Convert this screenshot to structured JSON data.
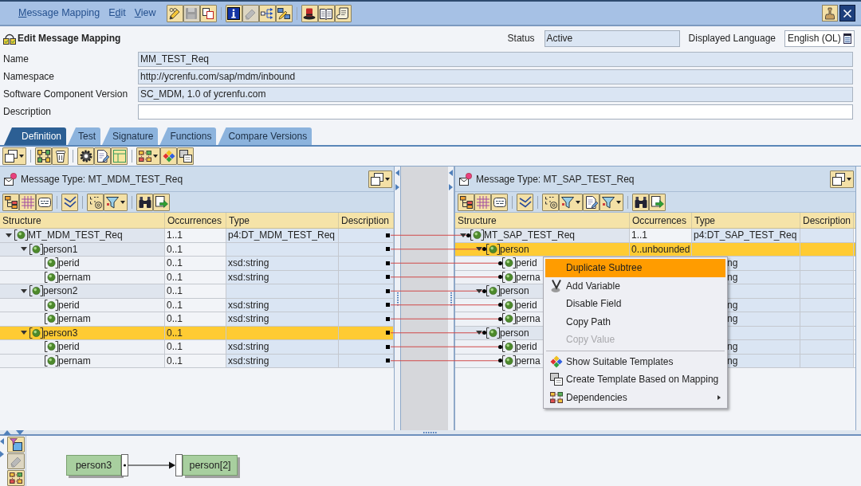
{
  "menu_bar": {
    "items": [
      {
        "key": "M",
        "post": "essage Mapping"
      },
      {
        "pre": "E",
        "key": "d",
        "post": "it"
      },
      {
        "key": "V",
        "post": "iew"
      }
    ]
  },
  "toolbar": {
    "groups": [
      [
        {
          "kind": "edit",
          "disabled": false
        },
        {
          "kind": "save",
          "disabled": true
        },
        {
          "kind": "copy",
          "disabled": false
        }
      ],
      [
        {
          "kind": "info",
          "disabled": false
        },
        {
          "kind": "eraser",
          "disabled": true
        },
        {
          "kind": "network",
          "disabled": false
        },
        {
          "kind": "compare",
          "disabled": false
        }
      ],
      [
        {
          "kind": "hat",
          "disabled": false
        },
        {
          "kind": "book",
          "disabled": false
        },
        {
          "kind": "scroll",
          "disabled": false
        }
      ]
    ]
  },
  "editor": {
    "title": "Edit Message Mapping",
    "status": {
      "label": "Status",
      "value": "Active"
    },
    "language": {
      "label": "Displayed Language",
      "value": "English (OL)"
    }
  },
  "fields": [
    {
      "label": "Name",
      "value": "MM_TEST_Req",
      "editable": false
    },
    {
      "label": "Namespace",
      "value": "http://ycrenfu.com/sap/mdm/inbound",
      "editable": false
    },
    {
      "label": "Software Component Version",
      "value": "SC_MDM, 1.0 of ycrenfu.com",
      "editable": false
    },
    {
      "label": "Description",
      "editable": true
    }
  ],
  "tabs": [
    {
      "label": "Definition",
      "selected": true
    },
    {
      "label": "Test",
      "selected": false
    },
    {
      "label": "Signature",
      "selected": false
    },
    {
      "label": "Functions",
      "selected": false
    },
    {
      "label": "Compare Versions",
      "selected": false
    }
  ],
  "source": {
    "title": "Message Type: MT_MDM_TEST_Req",
    "columns": [
      "Structure",
      "Occurrences",
      "Type",
      "Description"
    ],
    "tree": [
      {
        "name": "MT_MDM_TEST_Req",
        "occurrences": "1..1",
        "type": "p4:DT_MDM_TEST_Req",
        "expanded": true,
        "selected": false,
        "mapped": true,
        "children": [
          {
            "name": "person1",
            "occurrences": "0..1",
            "expanded": true,
            "selected": false,
            "mapped": true,
            "children": [
              {
                "name": "perid",
                "occurrences": "0..1",
                "type": "xsd:string",
                "selected": false,
                "mapped": true
              },
              {
                "name": "pernam",
                "occurrences": "0..1",
                "type": "xsd:string",
                "selected": false,
                "mapped": true
              }
            ]
          },
          {
            "name": "person2",
            "occurrences": "0..1",
            "expanded": true,
            "selected": false,
            "mapped": true,
            "children": [
              {
                "name": "perid",
                "occurrences": "0..1",
                "type": "xsd:string",
                "selected": false,
                "mapped": true
              },
              {
                "name": "pernam",
                "occurrences": "0..1",
                "type": "xsd:string",
                "selected": false,
                "mapped": true
              }
            ]
          },
          {
            "name": "person3",
            "occurrences": "0..1",
            "expanded": true,
            "selected": true,
            "mapped": true,
            "children": [
              {
                "name": "perid",
                "occurrences": "0..1",
                "type": "xsd:string",
                "selected": false,
                "mapped": true
              },
              {
                "name": "pernam",
                "occurrences": "0..1",
                "type": "xsd:string",
                "selected": false,
                "mapped": true
              }
            ]
          }
        ]
      }
    ]
  },
  "target": {
    "title": "Message Type: MT_SAP_TEST_Req",
    "columns": [
      "Structure",
      "Occurrences",
      "Type",
      "Description"
    ],
    "tree": [
      {
        "name": "MT_SAP_TEST_Req",
        "occurrences": "1..1",
        "type": "p4:DT_SAP_TEST_Req",
        "expanded": true,
        "selected": false,
        "mapped": true,
        "children": [
          {
            "name": "person",
            "occurrences": "0..unbounded",
            "expanded": true,
            "selected": true,
            "mapped": true,
            "children": [
              {
                "name": "perid",
                "type": "ng",
                "selected": false,
                "mapped": true
              },
              {
                "name": "perna",
                "type": "ng",
                "selected": false,
                "mapped": true
              }
            ]
          },
          {
            "name": "person",
            "expanded": true,
            "selected": false,
            "mapped": true,
            "children": [
              {
                "name": "perid",
                "type": "ng",
                "selected": false,
                "mapped": true
              },
              {
                "name": "perna",
                "type": "ng",
                "selected": false,
                "mapped": true
              }
            ]
          },
          {
            "name": "person",
            "expanded": true,
            "selected": false,
            "mapped": true,
            "children": [
              {
                "name": "perid",
                "type": "ng",
                "selected": false,
                "mapped": true
              },
              {
                "name": "perna",
                "type": "ng",
                "selected": false,
                "mapped": true
              }
            ]
          }
        ]
      }
    ]
  },
  "context_menu": {
    "groups": [
      [
        {
          "label": "Duplicate Subtree",
          "kind": "plain",
          "selected": true,
          "disabled": false,
          "submenu": false
        },
        {
          "label": "Add Variable",
          "kind": "variable",
          "selected": false,
          "disabled": false,
          "submenu": false
        },
        {
          "label": "Disable Field",
          "kind": "plain",
          "selected": false,
          "disabled": false,
          "submenu": false
        },
        {
          "label": "Copy Path",
          "kind": "plain",
          "selected": false,
          "disabled": false,
          "submenu": false
        },
        {
          "label": "Copy Value",
          "kind": "plain",
          "selected": false,
          "disabled": true,
          "submenu": false
        }
      ],
      [
        {
          "label": "Show Suitable Templates",
          "kind": "diamonds",
          "selected": false,
          "disabled": false,
          "submenu": false
        },
        {
          "label": "Create Template Based on Mapping",
          "kind": "template",
          "selected": false,
          "disabled": false,
          "submenu": false
        },
        {
          "label": "Dependencies",
          "kind": "dependencies",
          "selected": false,
          "disabled": false,
          "submenu": true
        }
      ]
    ]
  },
  "mapping_diagram": {
    "nodes": [
      {
        "label": "person3"
      },
      {
        "label": "person[2]"
      }
    ]
  },
  "side_toolbar": [
    {
      "kind": "filter_box",
      "disabled": false
    },
    {
      "kind": "eraser",
      "disabled": true
    },
    {
      "kind": "dependencies",
      "disabled": false
    }
  ]
}
